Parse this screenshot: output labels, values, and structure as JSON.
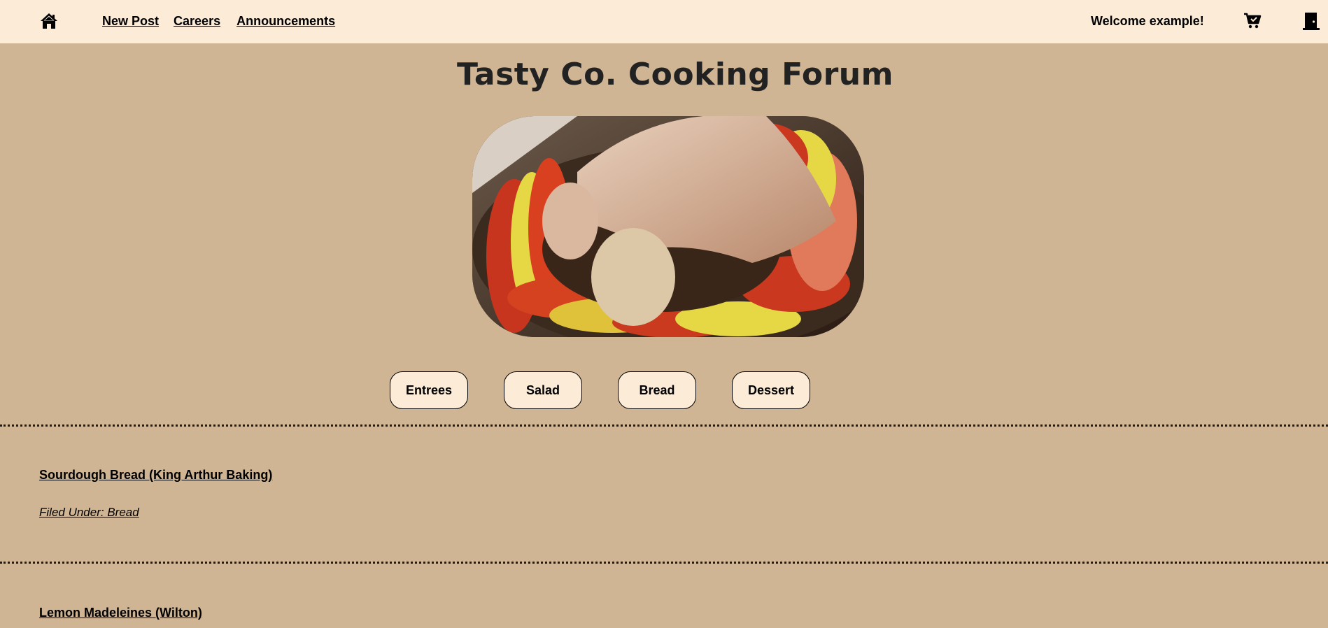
{
  "nav": {
    "home_icon": "home-icon",
    "links": [
      "New Post",
      "Careers",
      "Announcements"
    ],
    "welcome": "Welcome example!",
    "cart_icon": "cart-icon",
    "exit_icon": "door-exit-icon"
  },
  "page": {
    "title": "Tasty Co. Cooking Forum"
  },
  "hero": {
    "image": "ratatouille-arranging-photo"
  },
  "categories": [
    "Entrees",
    "Salad",
    "Bread",
    "Dessert"
  ],
  "posts": [
    {
      "title": "Sourdough Bread (King Arthur Baking)",
      "category": "Filed Under: Bread"
    },
    {
      "title": "Lemon Madeleines (Wilton)"
    }
  ],
  "colors": {
    "background": "#cfb594",
    "topbar": "#fbebd7",
    "button_bg": "#fbebd7",
    "text": "#000000"
  }
}
